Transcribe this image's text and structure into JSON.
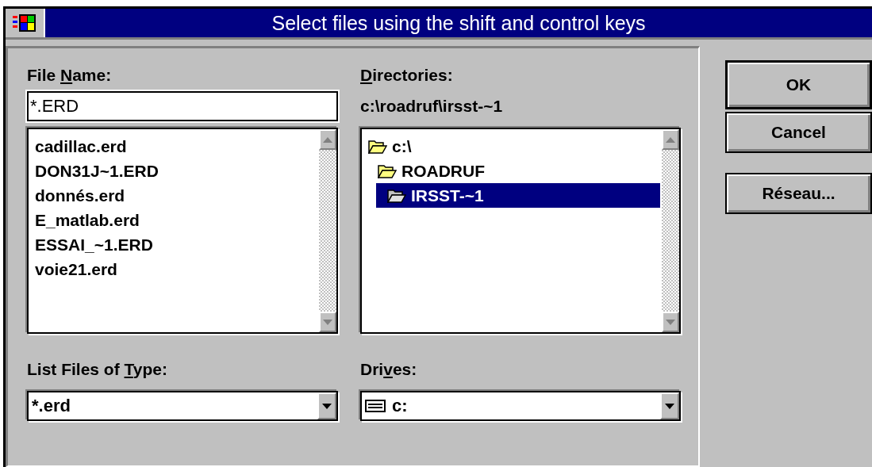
{
  "window": {
    "title": "Select files using the shift and control keys"
  },
  "file_name": {
    "label": {
      "before": "File ",
      "key": "N",
      "after": "ame:"
    },
    "value": "*.ERD"
  },
  "files": [
    {
      "name": "cadillac.erd",
      "selected": false
    },
    {
      "name": "DON31J~1.ERD",
      "selected": false
    },
    {
      "name": "donnés.erd",
      "selected": false
    },
    {
      "name": "E_matlab.erd",
      "selected": false
    },
    {
      "name": "ESSAI_~1.ERD",
      "selected": false
    },
    {
      "name": "voie21.erd",
      "selected": false
    }
  ],
  "directories": {
    "label": {
      "key": "D",
      "after": "irectories:"
    },
    "path": "c:\\roadruf\\irsst-~1",
    "tree": [
      {
        "name": "c:\\",
        "selected": false,
        "children": [
          {
            "name": "ROADRUF",
            "selected": false,
            "children": [
              {
                "name": "IRSST-~1",
                "selected": true
              }
            ]
          }
        ]
      }
    ]
  },
  "file_type": {
    "label": {
      "before": "List Files of ",
      "key": "T",
      "after": "ype:"
    },
    "value": "*.erd"
  },
  "drives": {
    "label": {
      "before": "Dri",
      "key": "v",
      "after": "es:"
    },
    "value": "c:"
  },
  "buttons": [
    {
      "label": "OK",
      "default": true
    },
    {
      "label": "Cancel",
      "default": false
    },
    {
      "label": "Réseau...",
      "default": false
    }
  ]
}
